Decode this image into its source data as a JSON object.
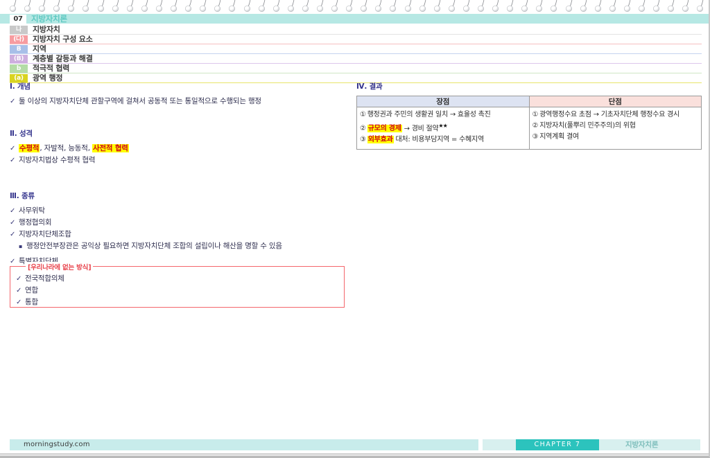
{
  "document": {
    "chapter_number": "07",
    "chapter_title": "지방자치론"
  },
  "outline": [
    {
      "badge": "나",
      "label": "지방자치"
    },
    {
      "badge": "(다)",
      "label": "지방자치 구성 요소"
    },
    {
      "badge": "B",
      "label": "지역"
    },
    {
      "badge": "(B)",
      "label": "계층별 갈등과 해결"
    },
    {
      "badge": "b",
      "label": "적극적 협력"
    },
    {
      "badge": "(a)",
      "label": "광역 행정"
    }
  ],
  "sections": {
    "concept": {
      "title": "Ⅰ. 개념",
      "items": [
        "둘 이상의 지방자치단체 관할구역에 걸쳐서 공동적 또는 통일적으로 수행되는 행정"
      ]
    },
    "character": {
      "title": "Ⅱ. 성격",
      "line1_a": "수평적",
      "line1_b": ", 자발적, 능동적, ",
      "line1_c": "사전적 협력",
      "line2": "지방자치법상 수평적 협력"
    },
    "types": {
      "title": "Ⅲ. 종류",
      "items": [
        "사무위탁",
        "행정협의회",
        "지방자치단체조합",
        "특별자치단체"
      ],
      "sub_note": "행정안전부장관은 공익상 필요하면 지방자치단체 조합의 설립이나 해산을 명할 수 있음"
    },
    "notbox": {
      "title": "[우리나라에 없는 방식]",
      "items": [
        "전국적합의체",
        "연합",
        "통합"
      ]
    },
    "results": {
      "title": "Ⅳ. 결과",
      "header_pro": "장점",
      "header_con": "단점",
      "pros": [
        {
          "num": "①",
          "pre": "행정권과 주민의 생활권 일치  → 효율성 촉진",
          "hl": "",
          "post": "",
          "stars": ""
        },
        {
          "num": "②",
          "pre": "",
          "hl": "규모의 경제",
          "post": " → 경비 절약",
          "stars": "★★"
        },
        {
          "num": "③",
          "pre": "",
          "hl": "외부효과",
          "post": " 대처: 비용부담지역 = 수혜지역",
          "stars": ""
        }
      ],
      "cons": [
        {
          "num": "①",
          "text": "광역행정수요 초점 → 기초자치단체 행정수요 경시"
        },
        {
          "num": "②",
          "text": "지방자치(풀뿌리 민주주의)의 위협"
        },
        {
          "num": "③",
          "text": "지역계획 결여"
        }
      ]
    }
  },
  "footer": {
    "site": "morningstudy.com",
    "chapter_tag": "CHAPTER 7",
    "subject": "지방자치론"
  },
  "colors": {
    "chapter_band": "#b6e8e4",
    "accent_teal": "#2cc3bd",
    "highlight": "#ffff00",
    "highlight_text": "#d0021b",
    "section_title": "#33338c",
    "redbox_border": "#f4666b",
    "table_pro_header": "#dde3f2",
    "table_con_header": "#fae0dc"
  }
}
